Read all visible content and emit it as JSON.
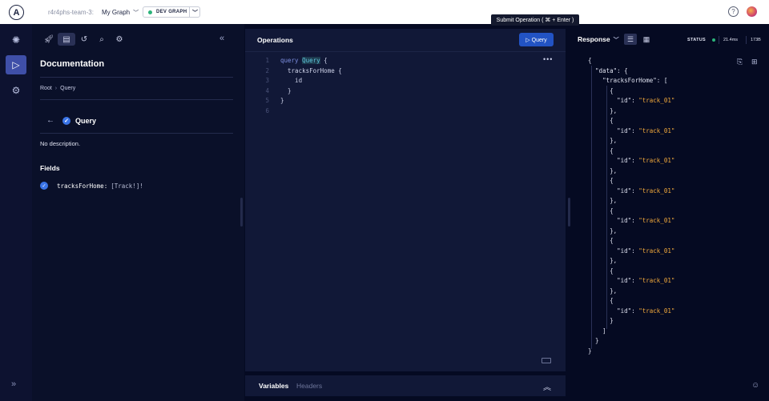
{
  "header": {
    "org": "r4r4phs-team-3:",
    "graph": "My Graph",
    "variant": "DEV GRAPH"
  },
  "tooltip": "Submit Operation ( ⌘ + Enter )",
  "docs": {
    "title": "Documentation",
    "breadcrumb": [
      "Root",
      "Query"
    ],
    "type_name": "Query",
    "description": "No description.",
    "fields_heading": "Fields",
    "field": {
      "name": "tracksForHome:",
      "type": "[Track!]!"
    }
  },
  "operations": {
    "title": "Operations",
    "run_label": "▷ Query",
    "code": [
      {
        "n": "1",
        "parts": [
          {
            "t": "query ",
            "c": "kw"
          },
          {
            "t": "Query",
            "c": "name"
          },
          {
            "t": " {",
            "c": "plain"
          }
        ]
      },
      {
        "n": "2",
        "parts": [
          {
            "t": "  tracksForHome {",
            "c": "plain"
          }
        ]
      },
      {
        "n": "3",
        "parts": [
          {
            "t": "    id",
            "c": "plain"
          }
        ]
      },
      {
        "n": "4",
        "parts": [
          {
            "t": "  }",
            "c": "plain"
          }
        ]
      },
      {
        "n": "5",
        "parts": [
          {
            "t": "}",
            "c": "plain"
          }
        ]
      },
      {
        "n": "6",
        "parts": [
          {
            "t": "",
            "c": "plain"
          }
        ]
      }
    ]
  },
  "variables": {
    "tab1": "Variables",
    "tab2": "Headers"
  },
  "response": {
    "title": "Response",
    "status_label": "STATUS",
    "time": "21.4ms",
    "size": "173B",
    "root_key": "\"data\"",
    "list_key": "\"tracksForHome\"",
    "id_key": "\"id\"",
    "items": [
      "\"track_01\"",
      "\"track_01\"",
      "\"track_01\"",
      "\"track_01\"",
      "\"track_01\"",
      "\"track_01\"",
      "\"track_01\"",
      "\"track_01\""
    ]
  },
  "colors": {
    "accent": "#2253c4",
    "status_ok": "#2bb37a",
    "json_string": "#f2a93b"
  }
}
